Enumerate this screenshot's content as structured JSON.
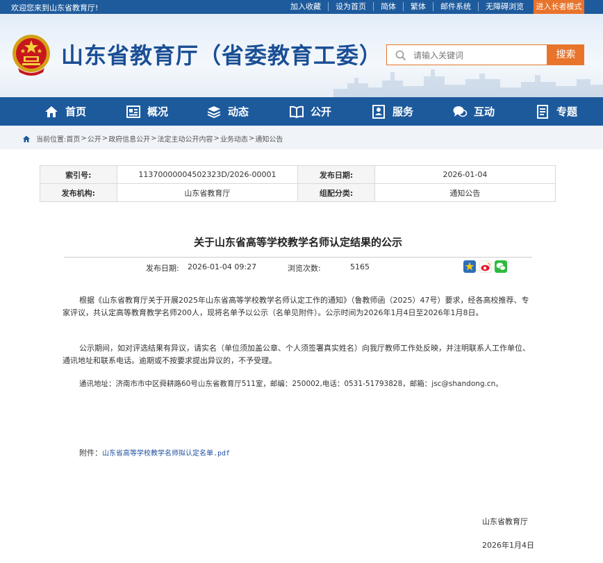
{
  "topbar": {
    "welcome": "欢迎您来到山东省教育厅!",
    "links": [
      "加入收藏",
      "设为首页",
      "简体",
      "繁体",
      "邮件系统",
      "无障碍浏览"
    ],
    "elder_mode": "进入长者模式"
  },
  "header": {
    "site_title": "山东省教育厅（省委教育工委）",
    "search_placeholder": "请输入关键词",
    "search_button": "搜索"
  },
  "nav": {
    "items": [
      {
        "label": "首页",
        "icon": "home-icon"
      },
      {
        "label": "概况",
        "icon": "overview-icon"
      },
      {
        "label": "动态",
        "icon": "news-stack-icon"
      },
      {
        "label": "公开",
        "icon": "open-book-icon"
      },
      {
        "label": "服务",
        "icon": "service-icon"
      },
      {
        "label": "互动",
        "icon": "chat-icon"
      },
      {
        "label": "专题",
        "icon": "topic-doc-icon"
      }
    ]
  },
  "breadcrumb": {
    "prefix": "当前位置:",
    "items": [
      "首页",
      "公开",
      "政府信息公开",
      "法定主动公开内容",
      "业务动态",
      "通知公告"
    ],
    "separator": ">"
  },
  "info_table": {
    "index_label": "索引号:",
    "index_value": "11370000004502323D/2026-00001",
    "publish_date_label": "发布日期:",
    "publish_date_value": "2026-01-04",
    "issuer_label": "发布机构:",
    "issuer_value": "山东省教育厅",
    "category_label": "组配分类:",
    "category_value": "通知公告"
  },
  "article": {
    "title": "关于山东省高等学校教学名师认定结果的公示",
    "date_label": "发布日期:",
    "date_value": "2026-01-04 09:27",
    "views_label": "浏览次数:",
    "views_value": "5165",
    "paragraphs": [
      "根据《山东省教育厅关于开展2025年山东省高等学校教学名师认定工作的通知》（鲁教师函（2025）47号）要求，经各高校推荐、专家评议，共认定高等教育教学名师200人，现将名单予以公示（名单见附件）。公示时间为2026年1月4日至2026年1月8日。",
      "公示期间，如对评选结果有异议，请实名（单位须加盖公章、个人须签署真实姓名）向我厅教师工作处反映，并注明联系人工作单位、通讯地址和联系电话。逾期或不按要求提出异议的，不予受理。",
      "通讯地址：济南市市中区舜耕路60号山东省教育厅511室，邮编：250002,电话：0531-51793828，邮箱：jsc@shandong.cn。"
    ],
    "attachment_label": "附件：",
    "attachment_link": "山东省高等学校教学名师拟认定名单.pdf",
    "signature": "山东省教育厅",
    "sign_date": "2026年1月4日"
  },
  "colors": {
    "primary_blue": "#1d5a9c",
    "accent_orange": "#e8742c"
  }
}
